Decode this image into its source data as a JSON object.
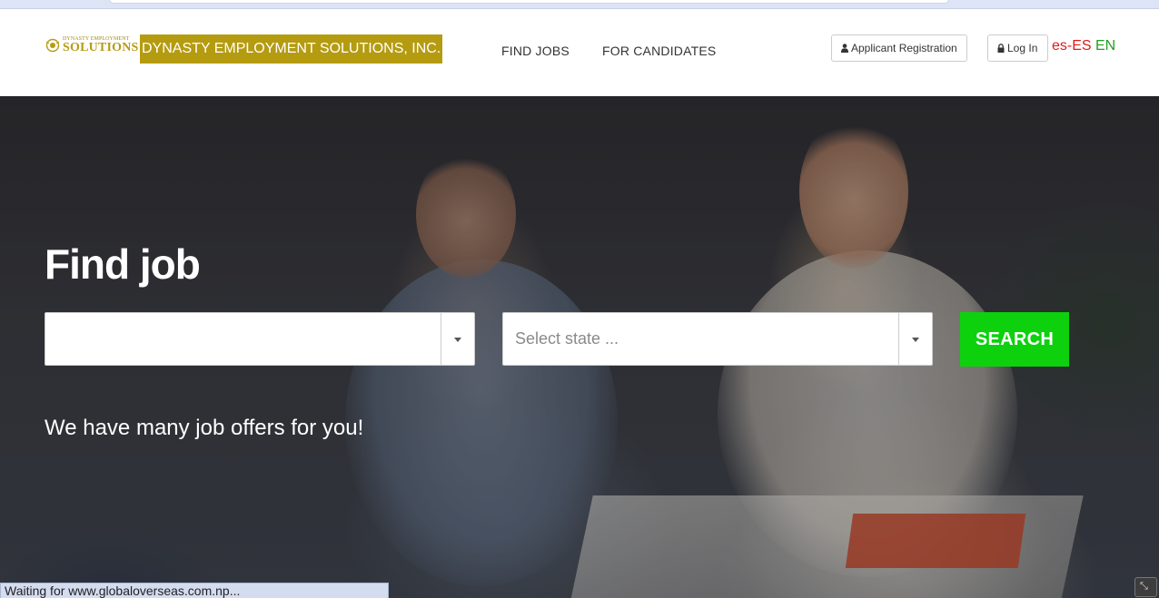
{
  "browser": {
    "status_text": "Waiting for www.globaloverseas.com.np..."
  },
  "header": {
    "logo": {
      "top_text": "DYNASTY EMPLOYMENT",
      "main_text": "SOLUTIONS"
    },
    "company_name": "DYNASTY EMPLOYMENT SOLUTIONS, INC.",
    "nav": {
      "find_jobs": "FIND JOBS",
      "for_candidates": "FOR CANDIDATES"
    },
    "applicant_registration": "Applicant Registration",
    "log_in": "Log In",
    "lang_es": "es-ES",
    "lang_en": "EN",
    "icons": {
      "registration": "user-icon",
      "login": "lock-icon"
    }
  },
  "hero": {
    "title": "Find job",
    "job_select": {
      "value": ""
    },
    "state_select": {
      "placeholder": "Select state ..."
    },
    "search_button": "SEARCH",
    "subtitle": "We have many job offers for you!"
  },
  "colors": {
    "brand_gold": "#b59b10",
    "search_green": "#0dd10d",
    "lang_es": "#e01b1b",
    "lang_en": "#22a022"
  }
}
